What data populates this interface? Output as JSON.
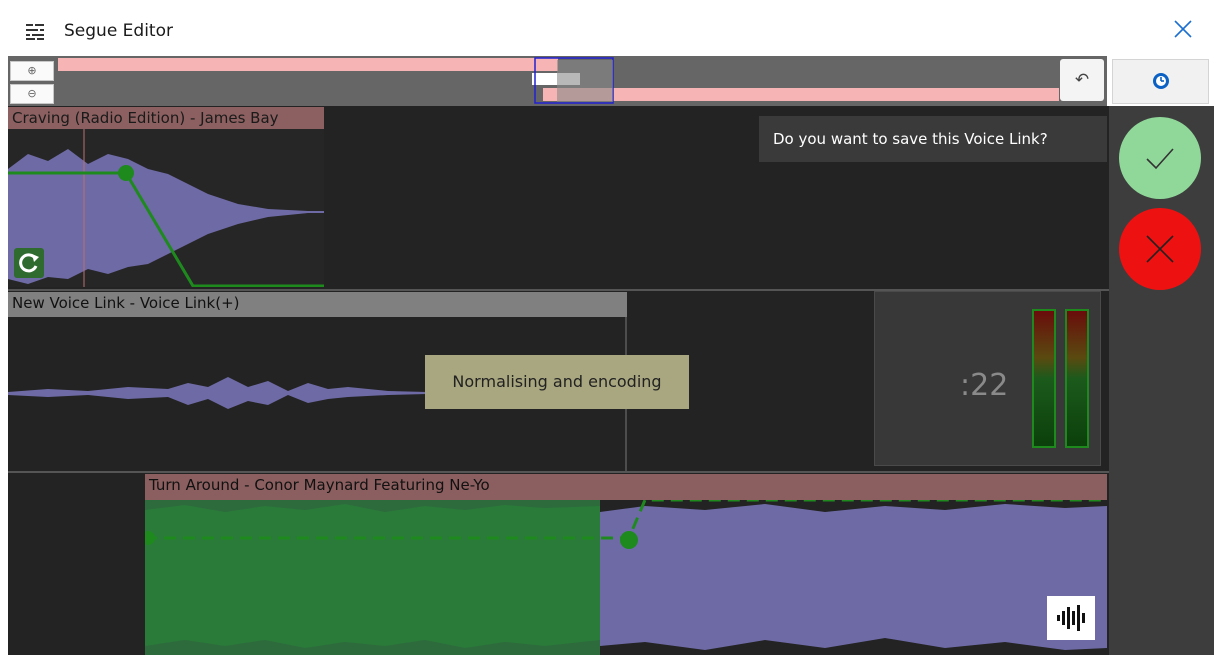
{
  "window": {
    "title": "Segue Editor",
    "app_icon": "sliders-icon",
    "close_icon": "close-icon"
  },
  "overview": {
    "zoom_in_icon": "zoom-in-icon",
    "zoom_out_icon": "zoom-out-icon",
    "undo_icon": "undo-icon",
    "clock_icon": "clock-icon"
  },
  "tracks": [
    {
      "title": "Craving (Radio Edition) - James Bay",
      "color": "#8c6060"
    },
    {
      "title": "New Voice Link - Voice Link(+)",
      "color": "#808080"
    },
    {
      "title": "Turn Around - Conor Maynard Featuring Ne-Yo",
      "color": "#8b5f5f"
    }
  ],
  "prompt": "Do you want to save this Voice Link?",
  "status": "Normalising and encoding",
  "timer": ":22",
  "actions": {
    "accept_icon": "check-icon",
    "reject_icon": "close-icon",
    "waveform_icon": "waveform-icon",
    "loop_icon": "refresh-icon"
  },
  "colors": {
    "waveform": "#6e6aa6",
    "fade": "#1e8a1e",
    "accept": "#90d89a",
    "reject": "#ee1111"
  }
}
